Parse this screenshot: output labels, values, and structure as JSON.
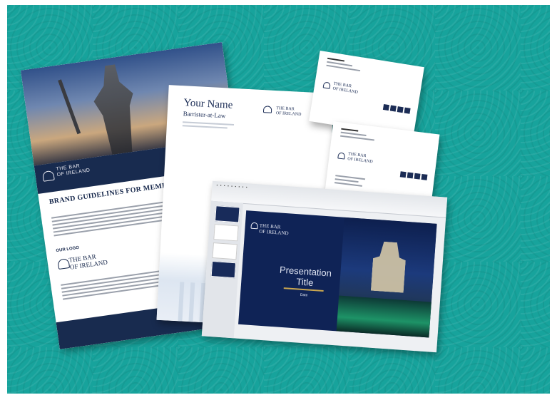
{
  "colors": {
    "background": "#17a39c",
    "navy": "#182b4f",
    "accent_pink": "#b0307a",
    "accent_gold": "#c9a650"
  },
  "brochure": {
    "logo_line1": "THE BAR",
    "logo_line2": "OF IRELAND",
    "title": "BRAND GUIDELINES FOR MEMBERS",
    "section_label": "OUR LOGO",
    "logo2_line1": "THE BAR",
    "logo2_line2": "OF IRELAND"
  },
  "letterhead": {
    "name": "Your Name",
    "role": "Barrister-at-Law",
    "logo_line1": "THE BAR",
    "logo_line2": "OF IRELAND"
  },
  "presentation": {
    "logo_line1": "THE BAR",
    "logo_line2": "OF IRELAND",
    "title_line1": "Presentation",
    "title_line2": "Title",
    "date": "Date"
  },
  "icons": [
    "bar-of-ireland-dome-icon",
    "social-icons"
  ]
}
